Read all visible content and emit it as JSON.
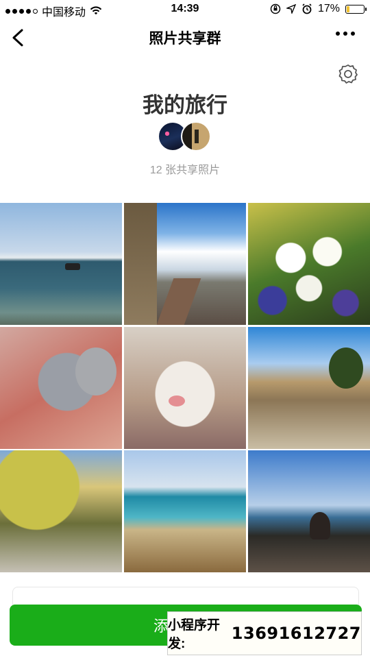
{
  "status_bar": {
    "carrier": "中国移动",
    "time": "14:39",
    "battery_percent": "17%",
    "battery_level": 0.17,
    "signal_bars_filled": 4,
    "icons": [
      "signal-icon",
      "wifi-icon",
      "orientation-lock-icon",
      "location-icon",
      "alarm-icon",
      "battery-icon"
    ]
  },
  "nav": {
    "title": "照片共享群",
    "back_icon": "chevron-left-icon",
    "more_icon": "more-dots-icon"
  },
  "album": {
    "settings_icon": "settings-icon",
    "title": "我的旅行",
    "photo_count_text": "12 张共享照片",
    "members": [
      "avatar-1",
      "avatar-2"
    ]
  },
  "photos": [
    {
      "name": "photo-sea-boat",
      "desc": "sea"
    },
    {
      "name": "photo-railway-station",
      "desc": "rail"
    },
    {
      "name": "photo-lily-bouquet",
      "desc": "flowers"
    },
    {
      "name": "photo-tabby-cat",
      "desc": "cat"
    },
    {
      "name": "photo-kitten-closeup",
      "desc": "kitten"
    },
    {
      "name": "photo-ancient-ruins",
      "desc": "ruins"
    },
    {
      "name": "photo-street-trees",
      "desc": "trees"
    },
    {
      "name": "photo-coast-beach",
      "desc": "beach"
    },
    {
      "name": "photo-seaside-terrace",
      "desc": "terrace"
    }
  ],
  "bottom": {
    "add_button_label": "添",
    "promo_label": "小程序开发:",
    "promo_phone": "13691612727"
  },
  "colors": {
    "primary_green": "#1aad19",
    "battery_yellow": "#f2c230",
    "muted_text": "#9a9a9a"
  }
}
